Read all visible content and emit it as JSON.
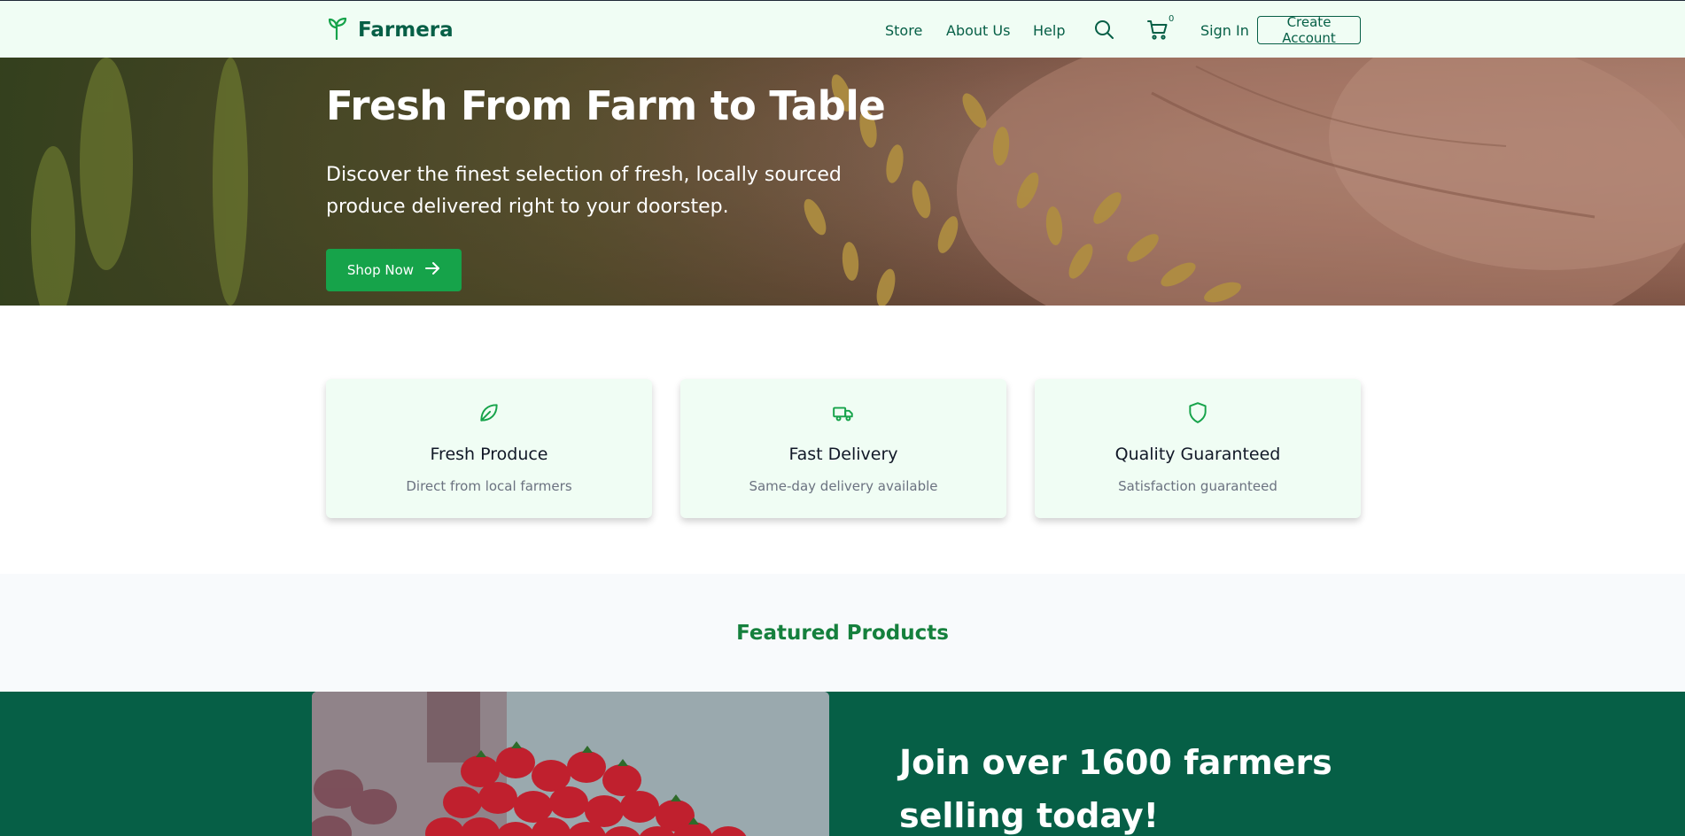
{
  "header": {
    "brand": "Farmera",
    "nav": [
      "Store",
      "About Us",
      "Help"
    ],
    "cart_count": "0",
    "sign_in": "Sign In",
    "create_account": "Create Account"
  },
  "hero": {
    "title": "Fresh From Farm to Table",
    "subtitle": "Discover the finest selection of fresh, locally sourced produce delivered right to your doorstep.",
    "cta": "Shop Now"
  },
  "features": [
    {
      "icon": "leaf-icon",
      "title": "Fresh Produce",
      "desc": "Direct from local farmers"
    },
    {
      "icon": "truck-icon",
      "title": "Fast Delivery",
      "desc": "Same-day delivery available"
    },
    {
      "icon": "shield-icon",
      "title": "Quality Guaranteed",
      "desc": "Satisfaction guaranteed"
    }
  ],
  "featured": {
    "title": "Featured Products"
  },
  "join": {
    "title": "Join over 1600 farmers selling today!"
  },
  "colors": {
    "brand_dark": "#065f46",
    "brand_green": "#16a34a",
    "header_bg": "#f0fdf4",
    "featured_title": "#15803d"
  }
}
